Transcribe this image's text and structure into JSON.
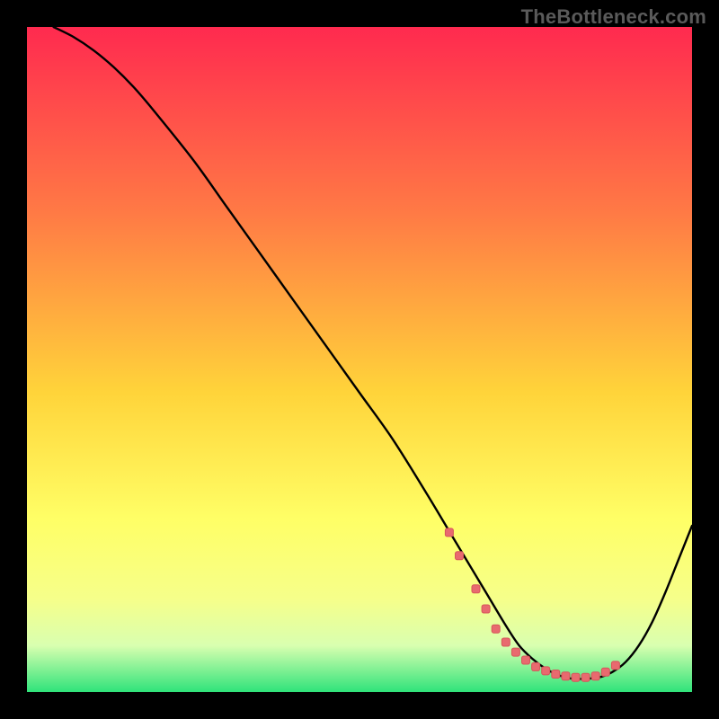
{
  "watermark": "TheBottleneck.com",
  "colors": {
    "page_bg": "#000000",
    "watermark": "#5a5a5a",
    "gradient_top": "#ff2a4f",
    "gradient_mid1": "#ff7a45",
    "gradient_mid2": "#ffd43a",
    "gradient_mid3": "#ffff66",
    "gradient_low1": "#f6ff8a",
    "gradient_low2": "#d9ffb0",
    "gradient_bottom": "#2fe37a",
    "curve": "#000000",
    "marker_fill": "#e86a6f",
    "marker_stroke": "#d6555a"
  },
  "chart_data": {
    "type": "line",
    "title": "",
    "xlabel": "",
    "ylabel": "",
    "xlim": [
      0,
      100
    ],
    "ylim": [
      0,
      100
    ],
    "grid": false,
    "legend": false,
    "series": [
      {
        "name": "curve",
        "x": [
          4,
          7,
          10,
          13,
          16,
          19,
          25,
          30,
          35,
          40,
          45,
          50,
          55,
          60,
          63,
          66,
          69,
          72,
          74,
          76,
          78,
          80,
          82,
          84,
          86,
          88,
          90,
          92,
          94,
          96,
          98,
          100
        ],
        "y": [
          100,
          98.5,
          96.5,
          94,
          91,
          87.5,
          80,
          73,
          66,
          59,
          52,
          45,
          38,
          30,
          25,
          20,
          15,
          10,
          7,
          5,
          3.5,
          2.5,
          2,
          2,
          2.2,
          3,
          4.5,
          7,
          10.5,
          15,
          20,
          25
        ]
      }
    ],
    "markers": {
      "name": "highlight-points",
      "x": [
        63.5,
        65,
        67.5,
        69,
        70.5,
        72,
        73.5,
        75,
        76.5,
        78,
        79.5,
        81,
        82.5,
        84,
        85.5,
        87,
        88.5
      ],
      "y": [
        24,
        20.5,
        15.5,
        12.5,
        9.5,
        7.5,
        6,
        4.8,
        3.8,
        3.2,
        2.7,
        2.4,
        2.2,
        2.2,
        2.4,
        3,
        4
      ]
    }
  }
}
